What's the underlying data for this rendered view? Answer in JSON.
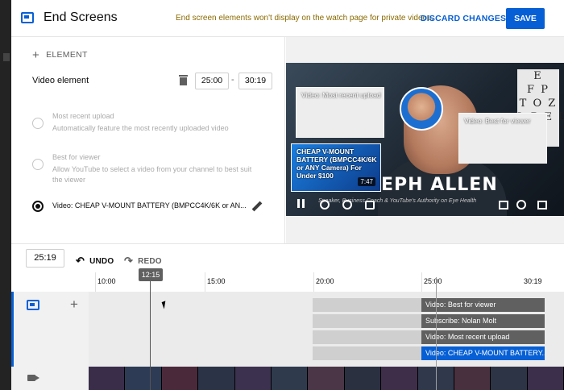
{
  "header": {
    "title": "End Screens",
    "notice": "End screen elements won't display on the watch page for private videos.",
    "discard_label": "DISCARD CHANGES",
    "save_label": "SAVE"
  },
  "editor": {
    "add_element_label": "ELEMENT",
    "selected_element_label": "Video element",
    "start_time": "25:00",
    "end_time": "30:19",
    "options": [
      {
        "title": "Most recent upload",
        "description": "Automatically feature the most recently uploaded video",
        "selected": false
      },
      {
        "title": "Best for viewer",
        "description": "Allow YouTube to select a video from your channel to best suit the viewer",
        "selected": false
      },
      {
        "title": "Video: CHEAP V-MOUNT BATTERY (BMPCC4K/6K or AN...",
        "description": "",
        "selected": true
      }
    ]
  },
  "preview": {
    "name_overlay": "EPH ALLEN",
    "subtitle_overlay": "Speaker, Business Coach & YouTube's Authority on Eye Health",
    "eye_chart": "E\nF P\nT O Z\nL P E D",
    "elements": [
      {
        "label": "Video: Most recent upload"
      },
      {
        "label": "Video: Best for viewer"
      },
      {
        "label": "CHEAP V-MOUNT BATTERY (BMPCC4K/6K or ANY Camera) For Under $100",
        "duration": "7:47"
      }
    ]
  },
  "toolbar": {
    "current_time": "25:19",
    "undo_label": "UNDO",
    "redo_label": "REDO"
  },
  "timeline": {
    "playhead_time": "12:15",
    "ticks": [
      "10:00",
      "15:00",
      "20:00",
      "25:00",
      "30:19"
    ],
    "segments": [
      {
        "label": "Video: Best for viewer",
        "selected": false
      },
      {
        "label": "Subscribe: Nolan Molt",
        "selected": false
      },
      {
        "label": "Video: Most recent upload",
        "selected": false
      },
      {
        "label": "Video: CHEAP V-MOUNT BATTERY...",
        "selected": true
      }
    ]
  },
  "colors": {
    "accent": "#065fd4",
    "notice": "#8a6a00",
    "segment": "#606060"
  }
}
